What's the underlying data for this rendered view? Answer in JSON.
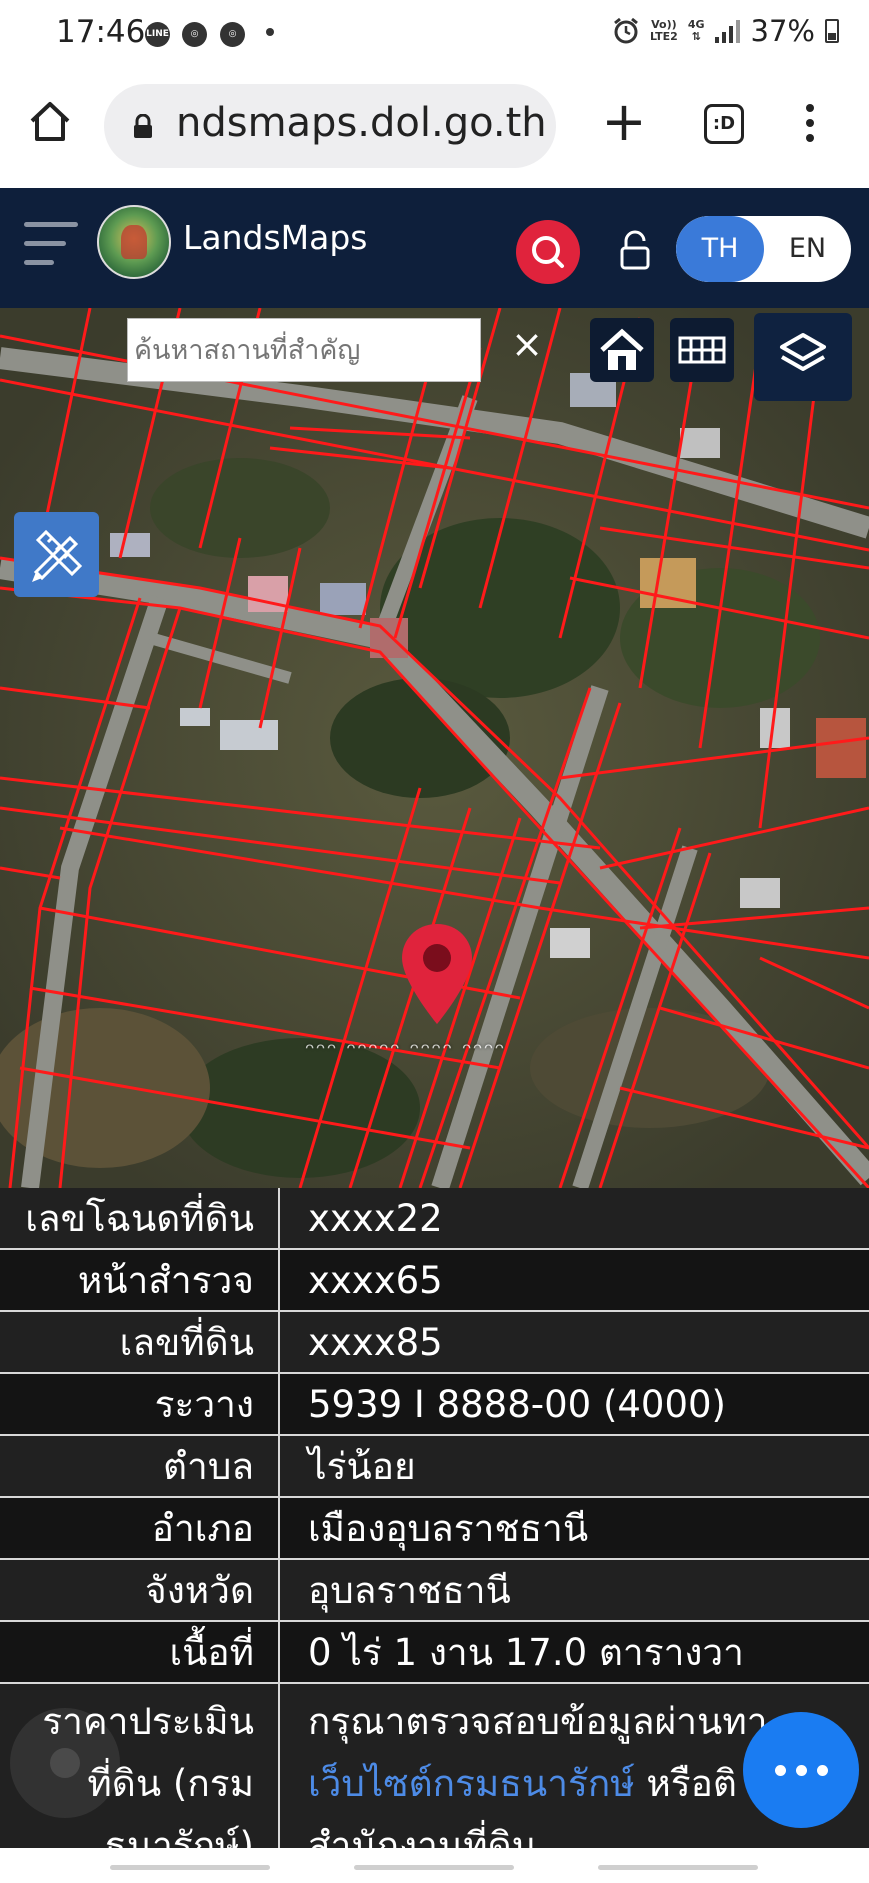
{
  "status_bar": {
    "time": "17:46",
    "app_icons": [
      "line-icon",
      "chrome-icon",
      "chrome-icon"
    ],
    "network_label_top": "Vo))",
    "network_label_bottom": "LTE2",
    "network_type": "4G",
    "battery": "37%"
  },
  "browser": {
    "url": "ndsmaps.dol.go.th",
    "tabs_label": ":D"
  },
  "app": {
    "title": "LandsMaps",
    "lang_th": "TH",
    "lang_en": "EN"
  },
  "map": {
    "search_placeholder": "ค้นหาสถานที่สำคัญ",
    "clear_label": "×",
    "colors": {
      "parcel_lines": "#ff1a1a",
      "pin": "#e0233c"
    }
  },
  "parcel_info": {
    "rows": [
      {
        "label": "เลขโฉนดที่ดิน",
        "value": "xxxx22"
      },
      {
        "label": "หน้าสำรวจ",
        "value": "xxxx65"
      },
      {
        "label": "เลขที่ดิน",
        "value": "xxxx85"
      },
      {
        "label": "ระวาง",
        "value": "5939 I 8888-00 (4000)"
      },
      {
        "label": "ตำบล",
        "value": "ไร่น้อย"
      },
      {
        "label": "อำเภอ",
        "value": "เมืองอุบลราชธานี"
      },
      {
        "label": "จังหวัด",
        "value": "อุบลราชธานี"
      },
      {
        "label": "เนื้อที่",
        "value": "0 ไร่ 1 งาน 17.0 ตารางวา"
      }
    ],
    "price": {
      "label_line1": "ราคาประเมิน",
      "label_line2": "ที่ดิน (กรม",
      "label_line3": "ธนารักษ์)",
      "value_line1": "กรุณาตรวจสอบข้อมูลผ่านทา",
      "value_link": "เว็บไซต์กรมธนารักษ์",
      "value_line2_rest": " หรือติ",
      "value_line3": "สำนักงานที่ดิน"
    }
  }
}
